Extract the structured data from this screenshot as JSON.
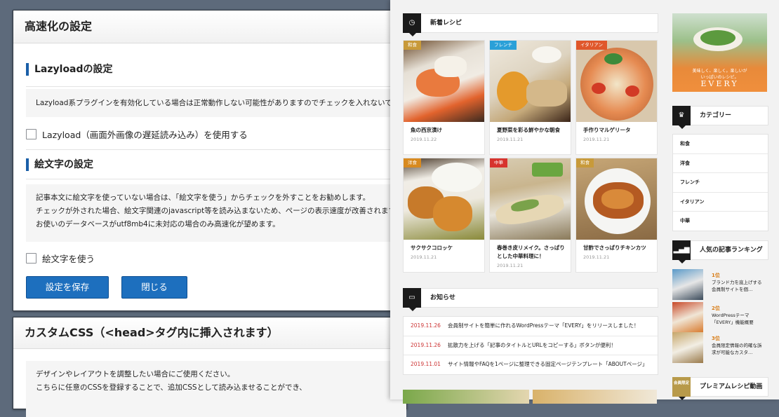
{
  "admin": {
    "speed_panel": {
      "title": "高速化の設定",
      "lazyload": {
        "heading": "Lazyloadの設定",
        "note": "Lazyload系プラグインを有効化している場合は正常動作しない可能性がありますのでチェックを入れないでくださ",
        "checkbox_label": "Lazyload（画面外画像の遅延読み込み）を使用する",
        "checked": false
      },
      "emoji": {
        "heading": "絵文字の設定",
        "note_lines": [
          "記事本文に絵文字を使っていない場合は、「絵文字を使う」からチェックを外すことをお勧めします。",
          "チェックが外された場合、絵文字関連のjavascript等を読み込まないため、ページの表示速度が改善されます。",
          "お使いのデータベースがutf8mb4に未対応の場合のみ高速化が望めます。"
        ],
        "checkbox_label": "絵文字を使う",
        "checked": false
      },
      "save_button": "設定を保存",
      "close_button": "閉じる"
    },
    "css_panel": {
      "title": "カスタムCSS（<head>タグ内に挿入されます）",
      "note_lines": [
        "デザインやレイアウトを調整したい場合にご使用ください。",
        "こちらに任意のCSSを登録することで、追加CSSとして読み込ませることができ、"
      ]
    }
  },
  "site": {
    "new_recipes": {
      "heading": "新着レシピ",
      "cards": [
        {
          "category": "和食",
          "title": "魚の西京漬け",
          "date": "2019.11.22",
          "cat_color": "#c89a3a"
        },
        {
          "category": "フレンチ",
          "title": "夏野菜を彩る鮮やかな朝食",
          "date": "2019.11.21",
          "cat_color": "#2aa0d8"
        },
        {
          "category": "イタリアン",
          "title": "手作りマルゲリータ",
          "date": "2019.11.21",
          "cat_color": "#e0572b"
        },
        {
          "category": "洋食",
          "title": "サクサクコロッケ",
          "date": "2019.11.21",
          "cat_color": "#d88a1f"
        },
        {
          "category": "中華",
          "title": "春巻き皮リメイク。さっぱりとした中華料理に！",
          "date": "2019.11.21",
          "cat_color": "#d7342e"
        },
        {
          "category": "和食",
          "title": "甘酢でさっぱりチキンカツ",
          "date": "2019.11.21",
          "cat_color": "#c89a3a"
        }
      ]
    },
    "news": {
      "heading": "お知らせ",
      "items": [
        {
          "date": "2019.11.26",
          "text": "会員制サイトを簡単に作れるWordPressテーマ「EVERY」をリリースしました！"
        },
        {
          "date": "2019.11.26",
          "text": "拡散力を上げる「記事のタイトルとURLをコピーする」ボタンが便利！"
        },
        {
          "date": "2019.11.01",
          "text": "サイト情報やFAQを1ページに整理できる固定ページテンプレート「ABOUTページ」"
        }
      ]
    },
    "banner": {
      "tagline": "美味しく、楽しく。楽しいがいっぱいのレシピ。",
      "brand": "EVERY"
    },
    "categories": {
      "heading": "カテゴリー",
      "items": [
        "和食",
        "洋食",
        "フレンチ",
        "イタリアン",
        "中華"
      ]
    },
    "ranking": {
      "heading": "人気の記事ランキング",
      "items": [
        {
          "rank": "1位",
          "title": "ブランド力を底上げする会員制サイトを個…"
        },
        {
          "rank": "2位",
          "title": "WordPressテーマ「EVERY」機能概要"
        },
        {
          "rank": "3位",
          "title": "会員限定情報の的確な訴求が可能なカスタ…"
        }
      ]
    },
    "premium": {
      "heading": "プレミアムレシピ動画",
      "badge": "会員限定"
    }
  }
}
